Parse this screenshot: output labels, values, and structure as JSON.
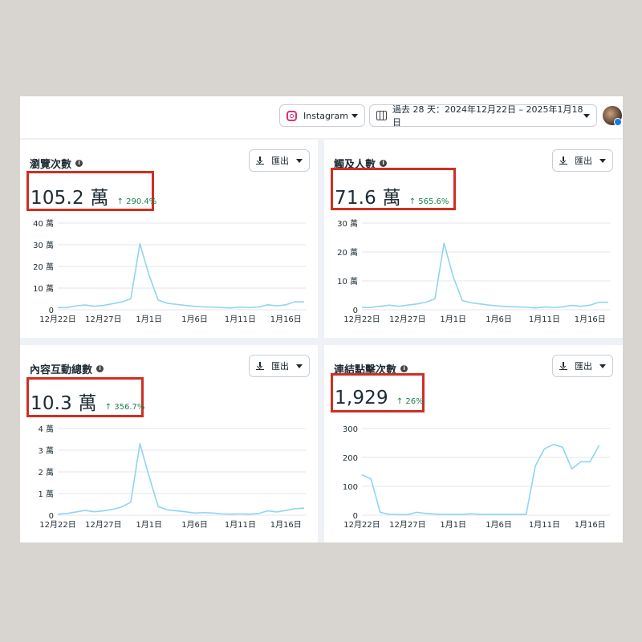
{
  "header": {
    "platform_label": "Instagram",
    "date_range_label": "過去 28 天：2024年12月22日 – 2025年1月18日"
  },
  "cards": [
    {
      "title": "瀏覽次數",
      "value": "105.2 萬",
      "change": "↑ 290.4%",
      "export_label": "匯出"
    },
    {
      "title": "觸及人數",
      "value": "71.6 萬",
      "change": "↑ 565.6%",
      "export_label": "匯出"
    },
    {
      "title": "內容互動總數",
      "value": "10.3 萬",
      "change": "↑ 356.7%",
      "export_label": "匯出"
    },
    {
      "title": "連結點擊次數",
      "value": "1,929",
      "change": "↑ 26%",
      "export_label": "匯出"
    }
  ],
  "colors": {
    "line": "#8fd4f4",
    "grid": "#e4e6eb",
    "highlight": "#cf2f22",
    "positive_change": "#1a7f4b"
  },
  "chart_data": [
    {
      "type": "line",
      "title": "瀏覽次數",
      "x_ticks": [
        "12月22日",
        "12月27日",
        "1月1日",
        "1月6日",
        "1月11日",
        "1月16日"
      ],
      "y_ticks": [
        "0",
        "10 萬",
        "20 萬",
        "30 萬",
        "40 萬"
      ],
      "ylim": [
        0,
        40
      ],
      "y": [
        1.0,
        1.0,
        1.8,
        2.2,
        1.6,
        2.0,
        2.8,
        3.6,
        5.0,
        30.5,
        16.0,
        4.5,
        3.0,
        2.5,
        2.0,
        1.6,
        1.3,
        1.2,
        1.0,
        0.8,
        1.3,
        1.0,
        1.3,
        2.3,
        1.8,
        2.3,
        3.7,
        3.6
      ],
      "grid": true
    },
    {
      "type": "line",
      "title": "觸及人數",
      "x_ticks": [
        "12月22日",
        "12月27日",
        "1月1日",
        "1月6日",
        "1月11日",
        "1月16日"
      ],
      "y_ticks": [
        "0",
        "10 萬",
        "20 萬",
        "30 萬"
      ],
      "ylim": [
        0,
        30
      ],
      "y": [
        0.8,
        0.8,
        1.2,
        1.6,
        1.2,
        1.6,
        2.0,
        2.6,
        3.8,
        23.0,
        11.5,
        3.2,
        2.4,
        2.0,
        1.6,
        1.3,
        1.1,
        1.0,
        0.9,
        0.6,
        1.0,
        0.8,
        1.0,
        1.5,
        1.2,
        1.6,
        2.6,
        2.6
      ],
      "grid": true
    },
    {
      "type": "line",
      "title": "內容互動總數",
      "x_ticks": [
        "12月22日",
        "12月27日",
        "1月1日",
        "1月6日",
        "1月11日",
        "1月16日"
      ],
      "y_ticks": [
        "0",
        "1 萬",
        "2 萬",
        "3 萬",
        "4 萬"
      ],
      "ylim": [
        0,
        4
      ],
      "y": [
        0.05,
        0.08,
        0.15,
        0.22,
        0.16,
        0.2,
        0.27,
        0.38,
        0.6,
        3.3,
        1.8,
        0.4,
        0.25,
        0.2,
        0.16,
        0.1,
        0.12,
        0.1,
        0.06,
        0.05,
        0.06,
        0.05,
        0.08,
        0.2,
        0.15,
        0.22,
        0.3,
        0.33
      ],
      "grid": true
    },
    {
      "type": "line",
      "title": "連結點擊次數",
      "x_ticks": [
        "12月22日",
        "12月27日",
        "1月1日",
        "1月6日",
        "1月11日",
        "1月16日"
      ],
      "y_ticks": [
        "0",
        "100",
        "200",
        "300"
      ],
      "ylim": [
        0,
        300
      ],
      "y": [
        140,
        125,
        10,
        3,
        2,
        2,
        10,
        6,
        4,
        3,
        3,
        3,
        5,
        3,
        3,
        3,
        3,
        3,
        3,
        170,
        230,
        245,
        235,
        160,
        185,
        185,
        242
      ],
      "grid": true
    }
  ]
}
